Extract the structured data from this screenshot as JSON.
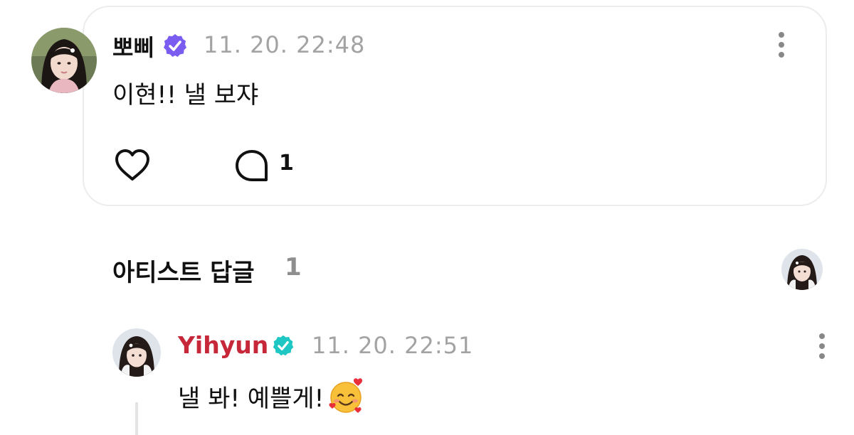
{
  "post": {
    "username": "뽀삐",
    "timestamp": "11. 20. 22:48",
    "message": "이현!! 낼 보쟈",
    "comment_count": "1",
    "verified_color": "#7b5cf0"
  },
  "artist_section": {
    "title": "아티스트 답글",
    "count": "1"
  },
  "reply": {
    "username": "Yihyun",
    "username_color": "#c6283a",
    "timestamp": "11. 20. 22:51",
    "message": "낼 봐! 예쁠게!",
    "emoji": "smiling-face-with-hearts",
    "verified_color": "#1ec7c3"
  },
  "icons": {
    "like": "heart-icon",
    "comment": "speech-bubble-icon",
    "more": "more-vertical-icon"
  }
}
